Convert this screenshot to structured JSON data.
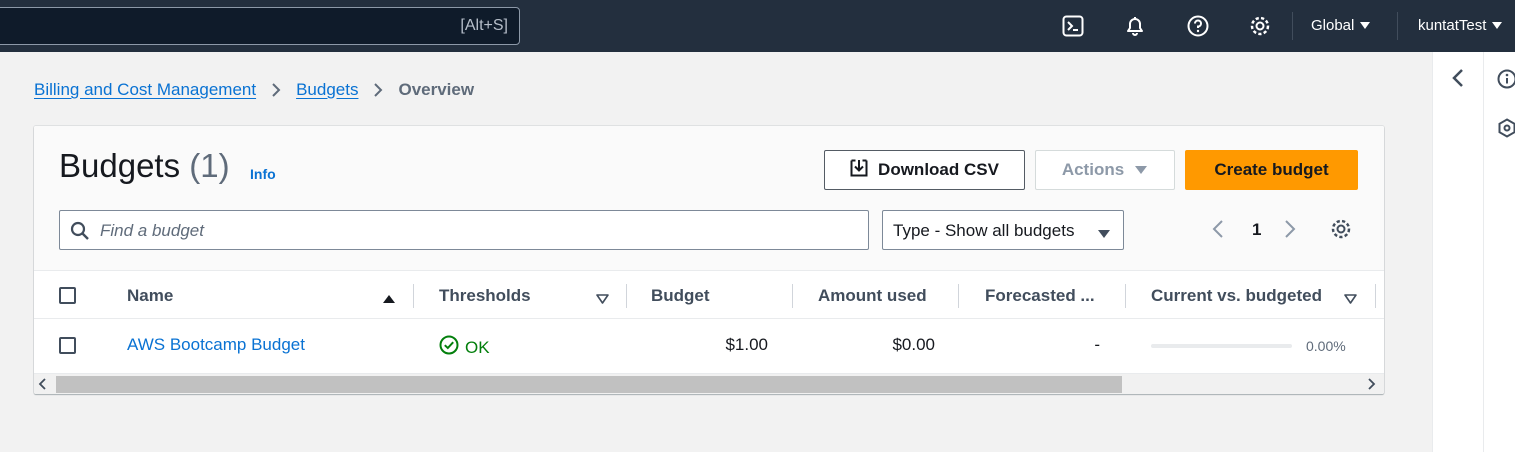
{
  "topnav": {
    "search_shortcut": "[Alt+S]",
    "region": "Global",
    "account": "kuntatTest",
    "icons": [
      "cloudshell-icon",
      "notifications-icon",
      "help-icon",
      "settings-icon"
    ]
  },
  "breadcrumb": {
    "items": [
      "Billing and Cost Management",
      "Budgets"
    ],
    "current": "Overview"
  },
  "card": {
    "title": "Budgets",
    "count": "(1)",
    "info": "Info",
    "download_label": "Download CSV",
    "actions_label": "Actions",
    "create_label": "Create budget",
    "search_placeholder": "Find a budget",
    "type_filter": "Type - Show all budgets",
    "page": "1"
  },
  "table": {
    "columns": [
      "Name",
      "Thresholds",
      "Budget",
      "Amount used",
      "Forecasted ...",
      "Current vs. budgeted"
    ],
    "rows": [
      {
        "name": "AWS Bootcamp Budget",
        "threshold": "OK",
        "budget": "$1.00",
        "amount_used": "$0.00",
        "forecasted": "-",
        "current_vs_budgeted": "0.00%",
        "progress_fraction": 0
      }
    ]
  },
  "colors": {
    "nav_bg": "#232f3e",
    "link": "#0972d3",
    "primary_button": "#ff9900",
    "success": "#037f0c"
  }
}
